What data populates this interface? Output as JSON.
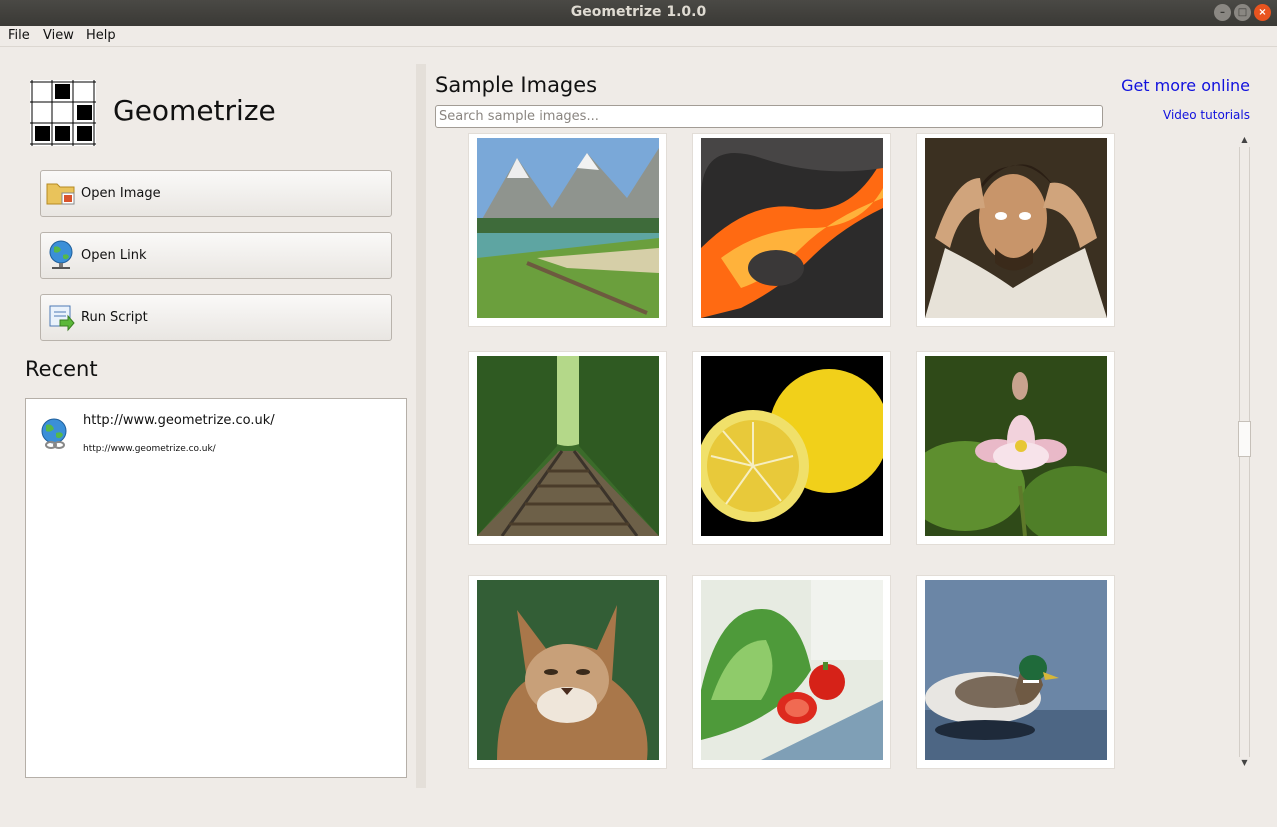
{
  "window": {
    "title": "Geometrize 1.0.0",
    "buttons": [
      "–",
      "□",
      "×"
    ]
  },
  "menubar": {
    "items": [
      "File",
      "View",
      "Help"
    ]
  },
  "app": {
    "name": "Geometrize"
  },
  "actions": {
    "open_image": "Open Image",
    "open_link": "Open Link",
    "run_script": "Run Script"
  },
  "recent": {
    "heading": "Recent",
    "items": [
      {
        "title": "http://www.geometrize.co.uk/",
        "subtitle": "http://www.geometrize.co.uk/",
        "icon": "globe-link-icon"
      }
    ]
  },
  "samples": {
    "heading": "Sample Images",
    "get_more": "Get more online",
    "video_tutorials": "Video tutorials",
    "search_placeholder": "Search sample images...",
    "images": [
      {
        "name": "mountain-lake-thumbnail"
      },
      {
        "name": "lava-thumbnail"
      },
      {
        "name": "desperate-man-portrait-thumbnail"
      },
      {
        "name": "railway-forest-thumbnail"
      },
      {
        "name": "lemon-thumbnail"
      },
      {
        "name": "lotus-flower-thumbnail"
      },
      {
        "name": "lynx-thumbnail"
      },
      {
        "name": "lettuce-tomato-thumbnail"
      },
      {
        "name": "mallard-duck-thumbnail"
      }
    ]
  },
  "colors": {
    "link": "#1111dd",
    "background": "#efebe7",
    "titlebar": "#3c3b37",
    "close": "#e9541f"
  }
}
